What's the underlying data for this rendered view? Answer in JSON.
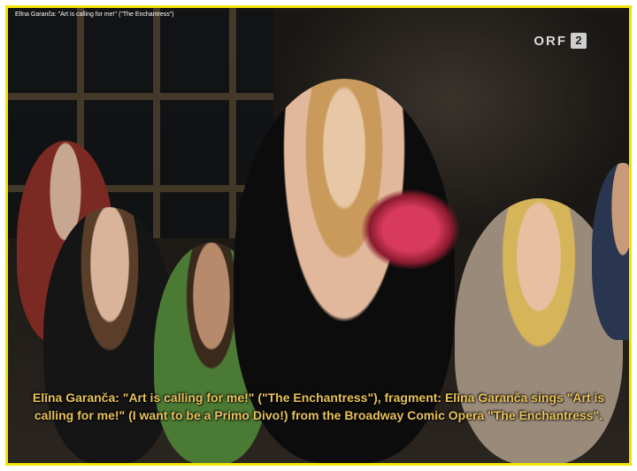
{
  "video": {
    "title": "Elīna Garanča: \"Art is calling for me!\" (\"The Enchantress\")",
    "channel_logo": {
      "text": "ORF",
      "number": "2"
    },
    "caption": "Elīna Garanča: \"Art is calling for me!\" (\"The Enchantress\"), fragment: Elīna Garanča sings \"Art is calling for me!\" (I want to be a Primo Divo!) from the Broadway Comic Opera \"The Enchantress\"."
  },
  "colors": {
    "frame_border": "#f2e600",
    "caption_text": "#e8c25a"
  }
}
